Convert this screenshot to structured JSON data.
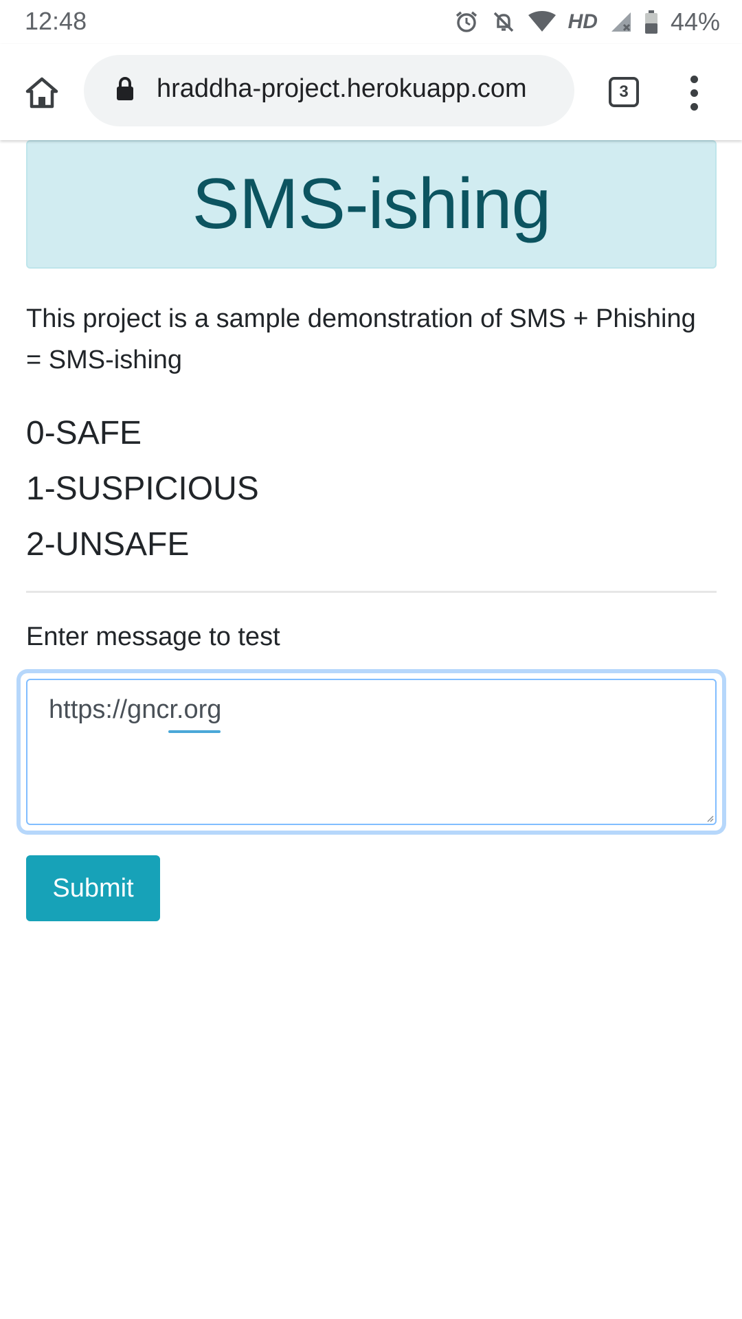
{
  "status_bar": {
    "time": "12:48",
    "network_label": "HD",
    "battery": "44%",
    "icons": [
      "alarm-icon",
      "notifications-off-icon",
      "wifi-icon",
      "cell-signal-icon",
      "battery-icon"
    ]
  },
  "browser": {
    "url": "hraddha-project.herokuapp.com",
    "tab_count": "3",
    "icons": [
      "home-icon",
      "lock-icon",
      "tabs-icon",
      "more-vert-icon"
    ]
  },
  "page": {
    "banner_title": "SMS-ishing",
    "intro": "This project is a sample demonstration of SMS + Phishing = SMS-ishing",
    "levels": [
      "0-SAFE",
      "1-SUSPICIOUS",
      "2-UNSAFE"
    ],
    "field_label": "Enter message to test",
    "message_value": "https://gncr.org",
    "submit_label": "Submit"
  },
  "colors": {
    "banner_bg": "#d1ecf1",
    "banner_text": "#0c5460",
    "button_bg": "#17a2b8",
    "focus_ring": "#b6d7fb"
  }
}
